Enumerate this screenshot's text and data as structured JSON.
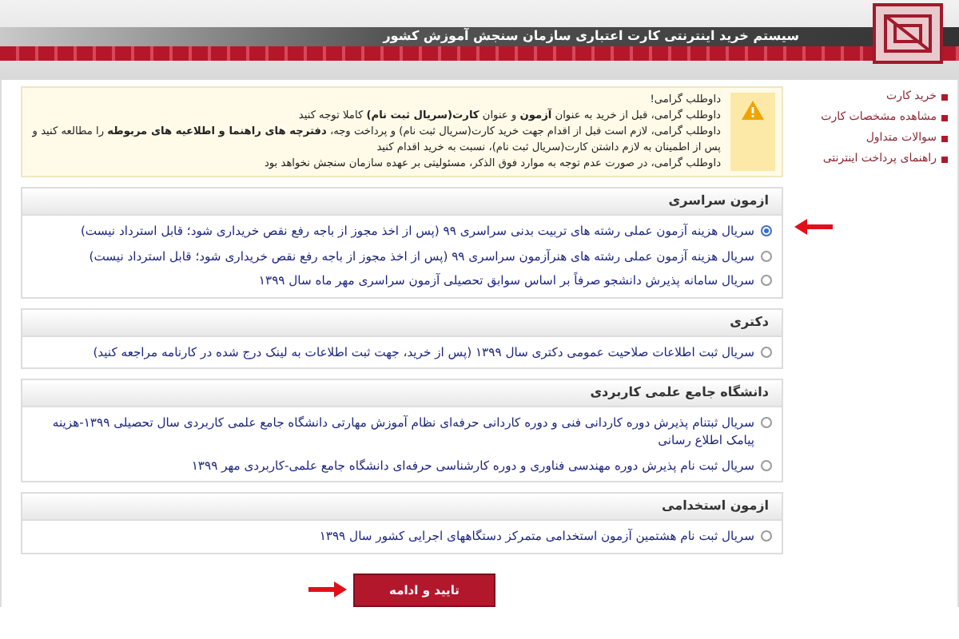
{
  "header": {
    "title": "سیستم خرید اینترنتی کارت اعتباری سازمان سنجش آموزش کشور"
  },
  "sidebar": {
    "items": [
      {
        "label": "خرید کارت"
      },
      {
        "label": "مشاهده مشخصات کارت"
      },
      {
        "label": "سوالات متداول"
      },
      {
        "label": "راهنمای پرداخت اینترنتی"
      }
    ]
  },
  "notice": {
    "title": "داوطلب گرامی!",
    "lines": [
      "داوطلب گرامی، قبل از خرید به عنوان **آزمون** و عنوان **کارت(سریال ثبت نام)** کاملا توجه کنید",
      "داوطلب گرامی، لازم است قبل از اقدام جهت خرید کارت(سریال ثبت نام) و پرداخت وجه، **دفترچه های راهنما و اطلاعیه های مربوطه** را مطالعه کنید و پس از اطمینان به لازم داشتن کارت(سریال ثبت نام)، نسبت به خرید اقدام کنید",
      "داوطلب گرامی، در صورت عدم توجه به موارد فوق الذکر، مسئولیتی بر عهده سازمان سنجش نخواهد بود"
    ]
  },
  "sections": [
    {
      "title": "ازمون سراسری",
      "options": [
        {
          "label": "سریال هزینه آزمون عملی رشته های تربیت بدنی سراسری ۹۹ (پس از اخذ مجوز از باجه رفع نقص خریداری شود؛ قابل استرداد نیست)",
          "selected": true
        },
        {
          "label": "سریال هزینه آزمون عملی رشته های هنرآزمون سراسری ۹۹ (پس از اخذ مجوز از باجه رفع نقص خریداری شود؛ قابل استرداد نیست)",
          "selected": false
        },
        {
          "label": "سریال سامانه پذیرش دانشجو صرفاً بر اساس سوابق تحصیلی آزمون سراسری مهر ماه سال ۱۳۹۹",
          "selected": false
        }
      ]
    },
    {
      "title": "دکتری",
      "options": [
        {
          "label": "سریال ثبت اطلاعات صلاحیت عمومی دکتری سال ۱۳۹۹ (پس از خرید، جهت ثبت اطلاعات به لینک درج شده در کارنامه مراجعه کنید)",
          "selected": false
        }
      ]
    },
    {
      "title": "دانشگاه جامع علمی کاربردی",
      "options": [
        {
          "label": "سریال ثبتنام پذیرش دوره کاردانی فنی و دوره کاردانی حرفه‌ای نظام آموزش مهارتی دانشگاه جامع علمی کاربردی سال تحصیلی ۱۳۹۹-هزینه پیامک اطلاع رسانی",
          "selected": false
        },
        {
          "label": "سریال ثبت نام پذیرش دوره مهندسی فناوری و دوره کارشناسی حرفه‌ای دانشگاه جامع علمی-کاربردی مهر ۱۳۹۹",
          "selected": false
        }
      ]
    },
    {
      "title": "ازمون استخدامی",
      "options": [
        {
          "label": "سریال ثبت نام هشتمین آزمون استخدامی متمرکز دستگاههای اجرایی کشور سال ۱۳۹۹",
          "selected": false
        }
      ]
    }
  ],
  "submit_button": {
    "label": "تایید و ادامه"
  }
}
